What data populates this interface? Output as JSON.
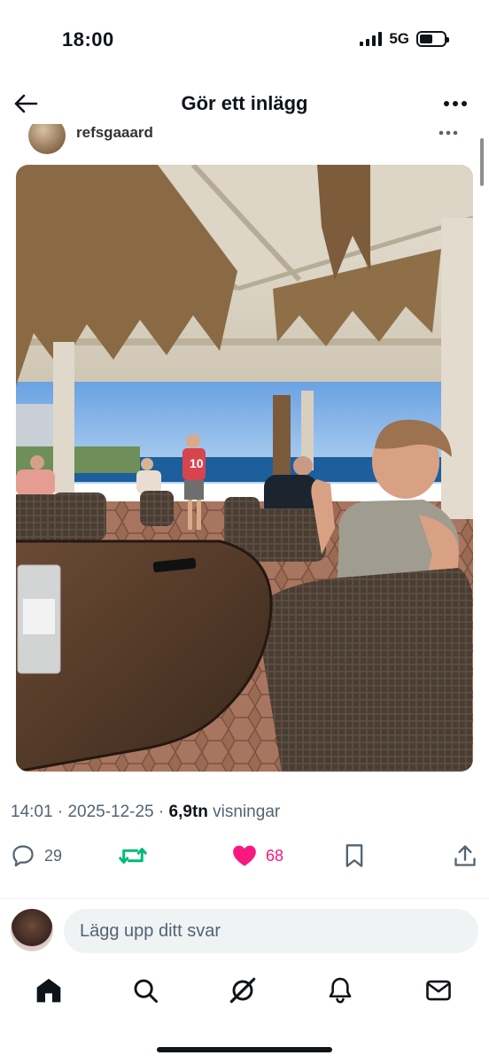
{
  "status_bar": {
    "time": "18:00",
    "network": "5G"
  },
  "header": {
    "title": "Gör ett inlägg"
  },
  "post": {
    "author": "refsgaaard",
    "time": "14:01",
    "date": "2025-12-25",
    "views": "6,9tn",
    "views_label": "visningar",
    "photo": {
      "jersey_number": "10",
      "scene": "beach-bar-terrace-sea-view"
    }
  },
  "actions": {
    "replies": "29",
    "likes": "68",
    "liked": true,
    "like_color": "#f91880",
    "repost_color": "#00ba7c"
  },
  "reply": {
    "placeholder": "Lägg upp ditt svar"
  },
  "tabbar": {
    "items": [
      {
        "icon": "home-icon",
        "active": true
      },
      {
        "icon": "search-icon"
      },
      {
        "icon": "grok-icon"
      },
      {
        "icon": "bell-icon"
      },
      {
        "icon": "mail-icon"
      }
    ]
  }
}
